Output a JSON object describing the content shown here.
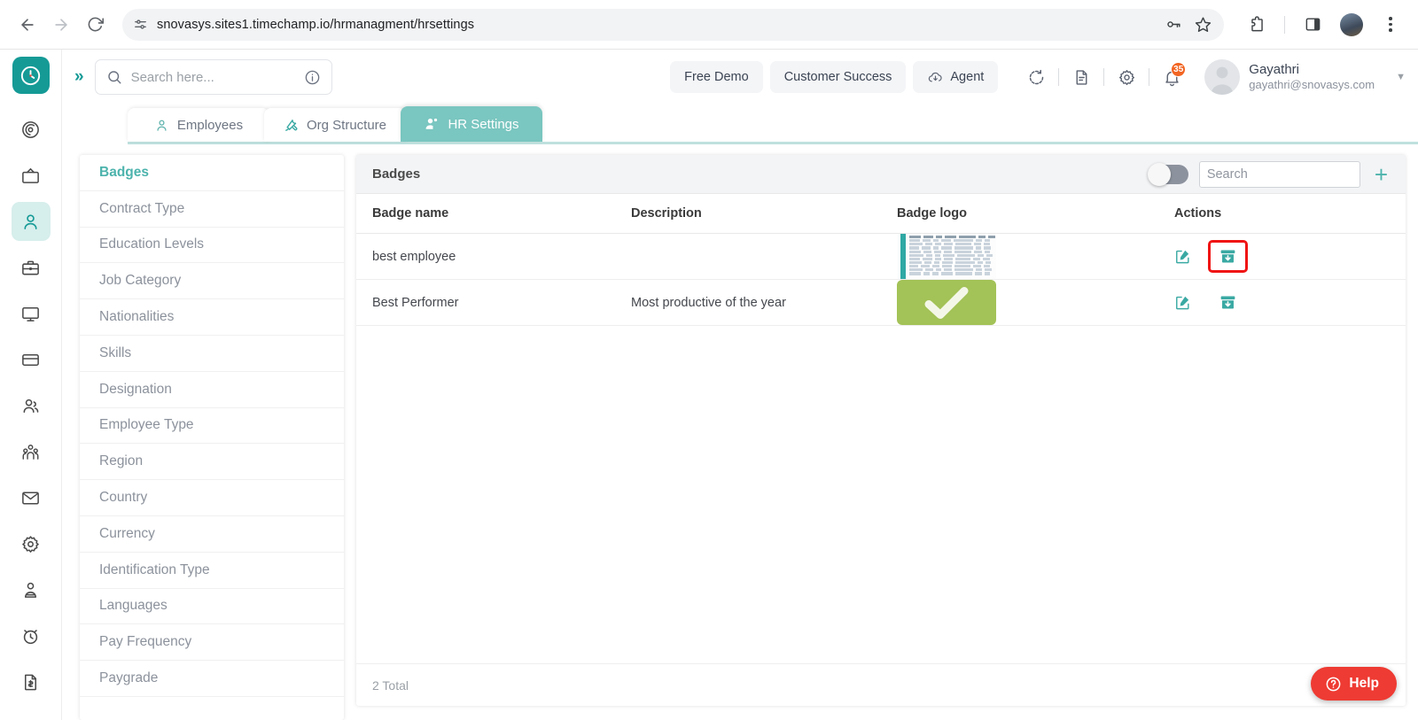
{
  "browser": {
    "url": "snovasys.sites1.timechamp.io/hrmanagment/hrsettings",
    "back_label": "Back",
    "forward_label": "Forward",
    "reload_label": "Reload",
    "site_info_label": "Site information",
    "password_label": "Saved passwords",
    "bookmark_label": "Bookmark this tab",
    "extensions_label": "Extensions",
    "sidepanel_label": "Side panel",
    "profile_label": "Profile",
    "menu_label": "Customize and control Chrome"
  },
  "topbar": {
    "search_placeholder": "Search here...",
    "info_label": "Info",
    "buttons": [
      {
        "label": "Free Demo",
        "icon": ""
      },
      {
        "label": "Customer Success",
        "icon": ""
      },
      {
        "label": "Agent",
        "icon": "cloud-download-icon"
      }
    ],
    "refresh_label": "Refresh",
    "docs_label": "Documents",
    "settings_label": "Settings",
    "notifications_label": "Notifications",
    "notification_count": "35",
    "user_name": "Gayathri",
    "user_email": "gayathri@snovasys.com"
  },
  "rail": {
    "logo_label": "TimeChamp",
    "expand_label": "Expand menu",
    "items": [
      {
        "name": "dashboard-icon",
        "label": "Dashboard",
        "active": false
      },
      {
        "name": "monitor-tv-icon",
        "label": "Live View",
        "active": false
      },
      {
        "name": "person-icon",
        "label": "HR Management",
        "active": true
      },
      {
        "name": "briefcase-icon",
        "label": "Projects",
        "active": false
      },
      {
        "name": "desktop-icon",
        "label": "Devices",
        "active": false
      },
      {
        "name": "card-icon",
        "label": "Payroll",
        "active": false
      },
      {
        "name": "users-icon",
        "label": "Teams",
        "active": false
      },
      {
        "name": "group-icon",
        "label": "Organization",
        "active": false
      },
      {
        "name": "mail-icon",
        "label": "Mail",
        "active": false
      },
      {
        "name": "gear-icon",
        "label": "Settings",
        "active": false
      },
      {
        "name": "user-tie-icon",
        "label": "Clients",
        "active": false
      },
      {
        "name": "alarm-clock-icon",
        "label": "Attendance",
        "active": false
      },
      {
        "name": "invoice-icon",
        "label": "Invoices",
        "active": false
      }
    ]
  },
  "tabs": [
    {
      "label": "Employees",
      "icon": "person-icon",
      "active": false
    },
    {
      "label": "Org Structure",
      "icon": "tools-icon",
      "active": false
    },
    {
      "label": "HR Settings",
      "icon": "person-gear-icon",
      "active": true
    }
  ],
  "settings_menu": {
    "items": [
      {
        "label": "Badges",
        "active": true
      },
      {
        "label": "Contract Type",
        "active": false
      },
      {
        "label": "Education Levels",
        "active": false
      },
      {
        "label": "Job Category",
        "active": false
      },
      {
        "label": "Nationalities",
        "active": false
      },
      {
        "label": "Skills",
        "active": false
      },
      {
        "label": "Designation",
        "active": false
      },
      {
        "label": "Employee Type",
        "active": false
      },
      {
        "label": "Region",
        "active": false
      },
      {
        "label": "Country",
        "active": false
      },
      {
        "label": "Currency",
        "active": false
      },
      {
        "label": "Identification Type",
        "active": false
      },
      {
        "label": "Languages",
        "active": false
      },
      {
        "label": "Pay Frequency",
        "active": false
      },
      {
        "label": "Paygrade",
        "active": false
      }
    ]
  },
  "panel": {
    "title": "Badges",
    "toggle_on": false,
    "toggle_label": "Show archived",
    "search_placeholder": "Search",
    "search_value": "",
    "add_label": "+",
    "columns": [
      "Badge name",
      "Description",
      "Badge logo",
      "Actions"
    ],
    "rows": [
      {
        "name": "best employee",
        "description": "",
        "logo_type": "spreadsheet-screenshot",
        "edit_label": "Edit",
        "archive_label": "Archive",
        "archive_highlighted": true
      },
      {
        "name": "Best Performer",
        "description": "Most productive of the year",
        "logo_type": "green-check",
        "edit_label": "Edit",
        "archive_label": "Archive",
        "archive_highlighted": false
      }
    ],
    "total_text": "2 Total"
  },
  "help": {
    "label": "Help"
  },
  "colors": {
    "brand_teal": "#159a96",
    "tab_active": "#7ac6c0",
    "accent_link": "#4cb3ac",
    "badge_orange": "#f26522",
    "help_red": "#ee3b33",
    "check_green": "#a3c257",
    "highlight_red": "#f01414"
  }
}
